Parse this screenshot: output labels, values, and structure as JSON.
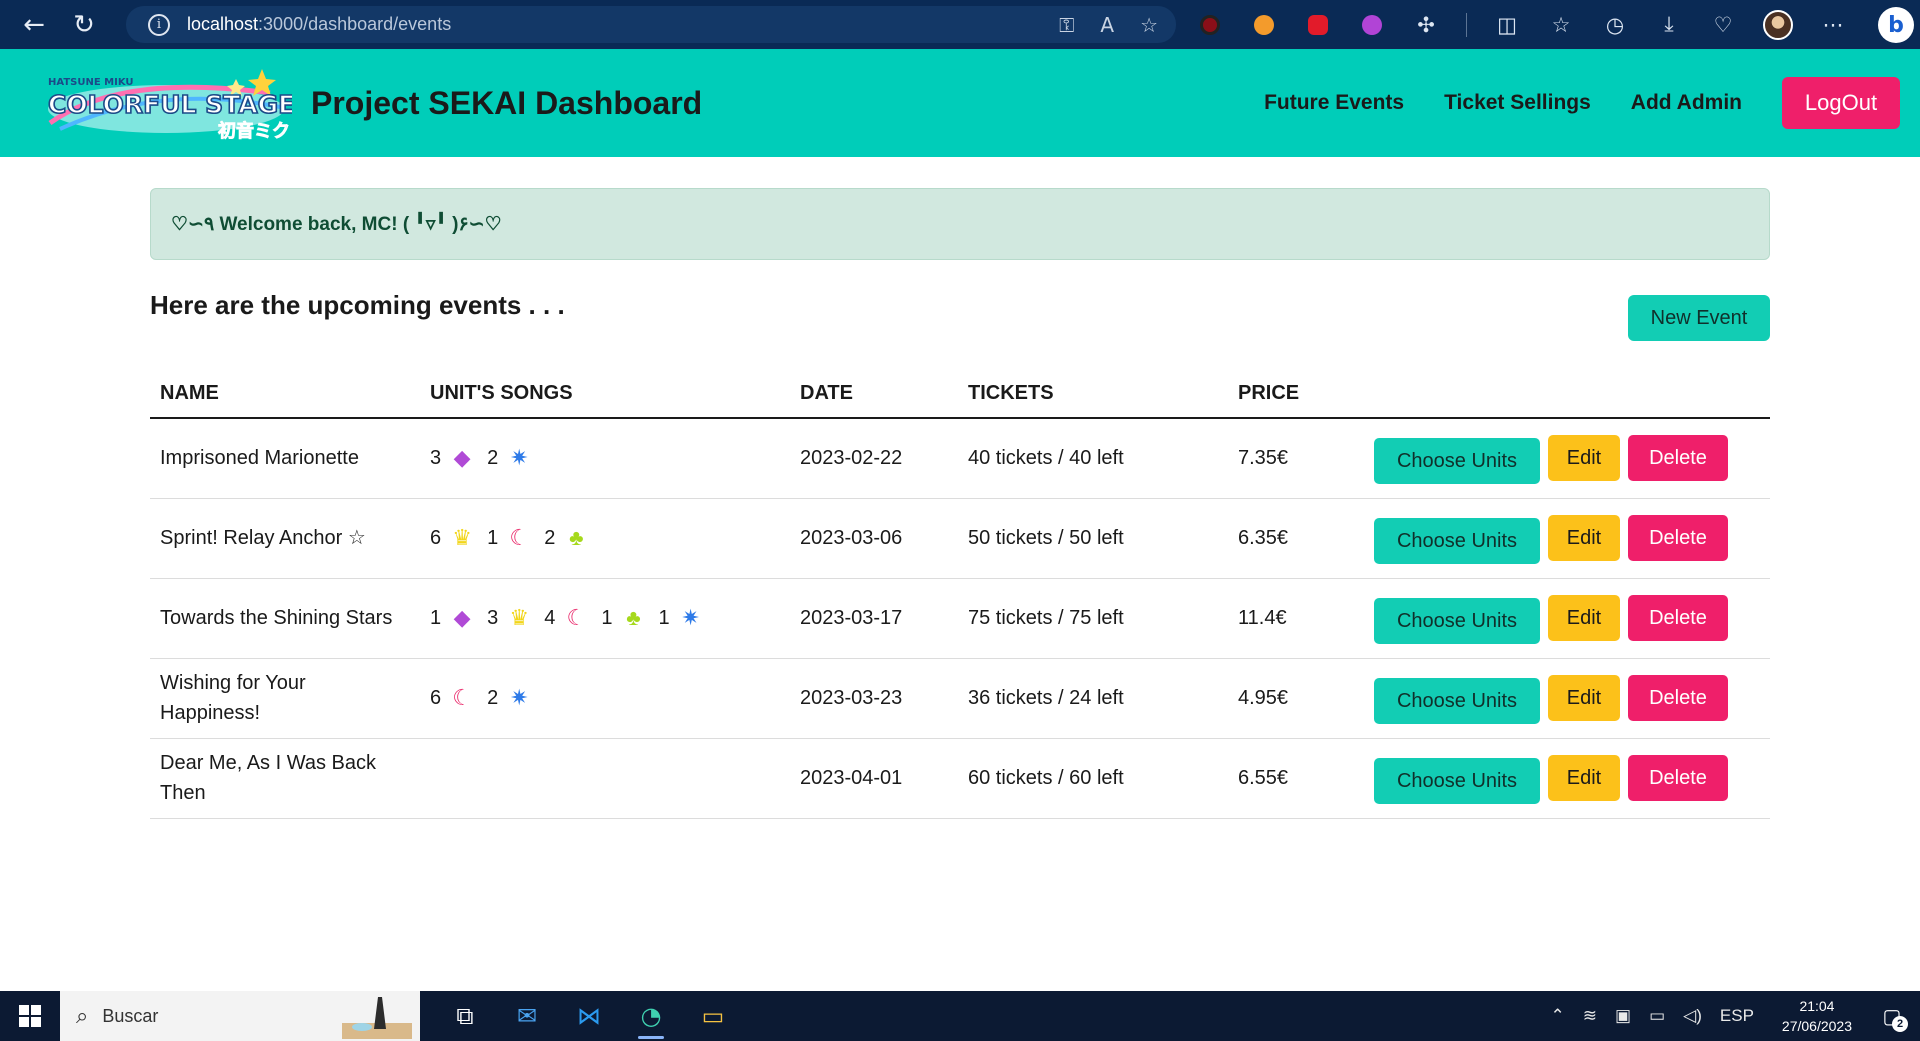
{
  "browser": {
    "url_host": "localhost",
    "url_rest": ":3000/dashboard/events"
  },
  "header": {
    "title": "Project SEKAI Dashboard",
    "nav": [
      {
        "label": "Future Events"
      },
      {
        "label": "Ticket Sellings"
      },
      {
        "label": "Add Admin"
      }
    ],
    "logout_label": "LogOut",
    "accent_color": "#00cdb9"
  },
  "alert": {
    "text": "♡∽٩ Welcome back, MC! ( ╹▿╹ )۶∽♡"
  },
  "events_section": {
    "title": "Here are the upcoming events . . .",
    "new_event_label": "New Event",
    "columns": [
      "NAME",
      "UNIT'S SONGS",
      "DATE",
      "TICKETS",
      "PRICE"
    ],
    "rows": [
      {
        "name": "Imprisoned Marionette",
        "songs": [
          {
            "count": "3",
            "icon": "purple-diamond-icon"
          },
          {
            "count": "2",
            "icon": "blue-star-swirl-icon"
          }
        ],
        "date": "2023-02-22",
        "tickets": "40 tickets / 40 left",
        "price": "7.35€"
      },
      {
        "name": "Sprint! Relay Anchor ☆",
        "songs": [
          {
            "count": "6",
            "icon": "yellow-crown-icon"
          },
          {
            "count": "1",
            "icon": "pink-moon-icon"
          },
          {
            "count": "2",
            "icon": "green-clover-icon"
          }
        ],
        "date": "2023-03-06",
        "tickets": "50 tickets / 50 left",
        "price": "6.35€"
      },
      {
        "name": "Towards the Shining Stars",
        "songs": [
          {
            "count": "1",
            "icon": "purple-diamond-icon"
          },
          {
            "count": "3",
            "icon": "yellow-crown-icon"
          },
          {
            "count": "4",
            "icon": "pink-moon-icon"
          },
          {
            "count": "1",
            "icon": "green-clover-icon"
          },
          {
            "count": "1",
            "icon": "blue-star-swirl-icon"
          }
        ],
        "date": "2023-03-17",
        "tickets": "75 tickets / 75 left",
        "price": "11.4€"
      },
      {
        "name": "Wishing for Your Happiness!",
        "songs": [
          {
            "count": "6",
            "icon": "pink-moon-icon"
          },
          {
            "count": "2",
            "icon": "blue-star-swirl-icon"
          }
        ],
        "date": "2023-03-23",
        "tickets": "36 tickets / 24 left",
        "price": "4.95€"
      },
      {
        "name": "Dear Me, As I Was Back Then",
        "songs": [],
        "date": "2023-04-01",
        "tickets": "60 tickets / 60 left",
        "price": "6.55€"
      }
    ],
    "actions": {
      "choose_units": "Choose Units",
      "edit": "Edit",
      "delete": "Delete"
    }
  },
  "taskbar": {
    "search_placeholder": "Buscar",
    "language": "ESP",
    "time": "21:04",
    "date": "27/06/2023",
    "notification_count": "2"
  }
}
